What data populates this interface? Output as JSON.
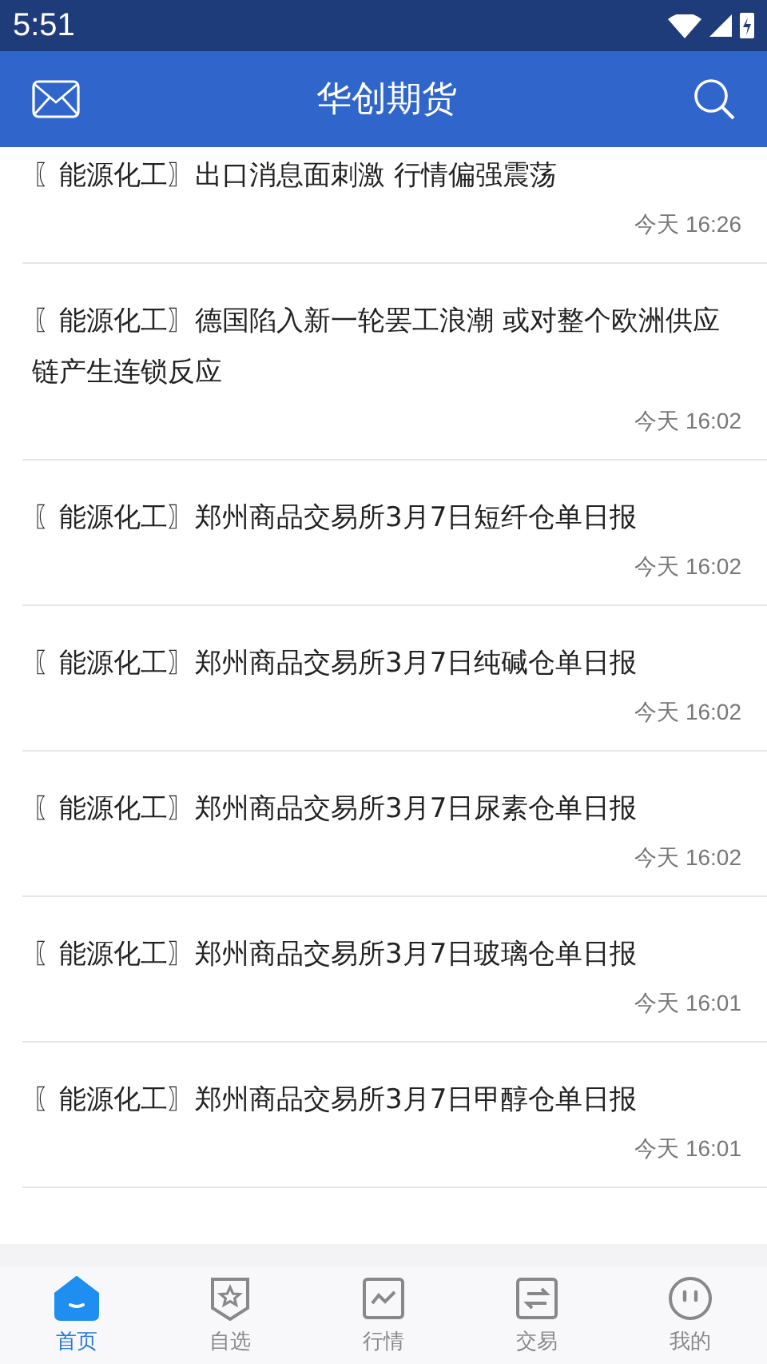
{
  "status_bar": {
    "time": "5:51"
  },
  "app_bar": {
    "title": "华创期货"
  },
  "news": [
    {
      "title": "〖能源化工〗出口消息面刺激 行情偏强震荡",
      "time": "今天 16:26"
    },
    {
      "title": "〖能源化工〗德国陷入新一轮罢工浪潮 或对整个欧洲供应链产生连锁反应",
      "time": "今天 16:02"
    },
    {
      "title": "〖能源化工〗郑州商品交易所3月7日短纤仓单日报",
      "time": "今天 16:02"
    },
    {
      "title": "〖能源化工〗郑州商品交易所3月7日纯碱仓单日报",
      "time": "今天 16:02"
    },
    {
      "title": "〖能源化工〗郑州商品交易所3月7日尿素仓单日报",
      "time": "今天 16:02"
    },
    {
      "title": "〖能源化工〗郑州商品交易所3月7日玻璃仓单日报",
      "time": "今天 16:01"
    },
    {
      "title": "〖能源化工〗郑州商品交易所3月7日甲醇仓单日报",
      "time": "今天 16:01"
    }
  ],
  "tabs": [
    {
      "kind": "home",
      "label": "首页",
      "selected": true
    },
    {
      "kind": "watchlist",
      "label": "自选",
      "selected": false
    },
    {
      "kind": "market",
      "label": "行情",
      "selected": false
    },
    {
      "kind": "trade",
      "label": "交易",
      "selected": false
    },
    {
      "kind": "profile",
      "label": "我的",
      "selected": false
    }
  ]
}
